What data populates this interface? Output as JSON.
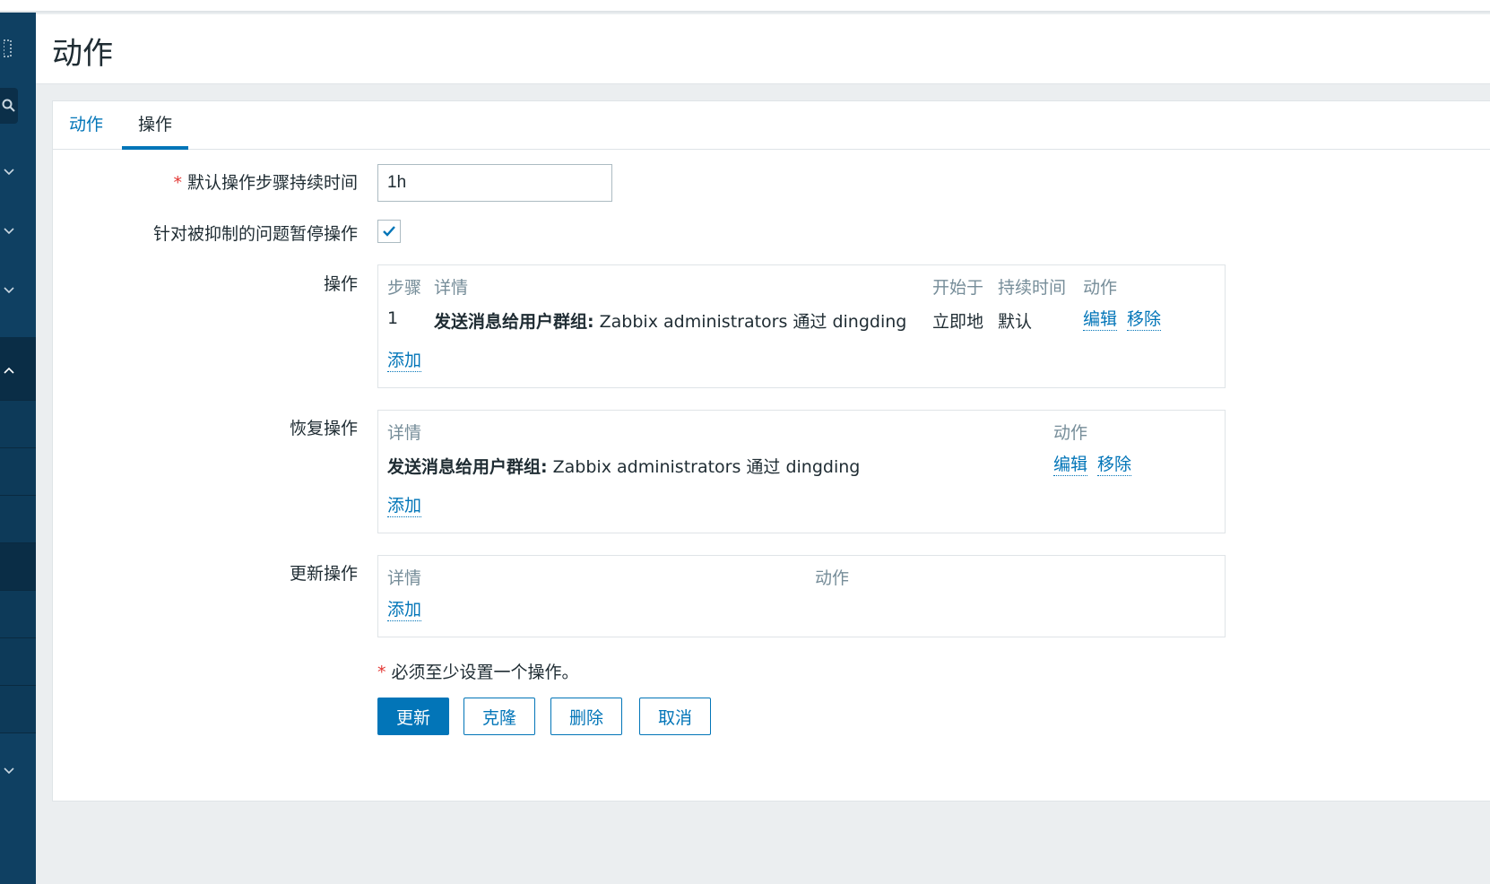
{
  "header": {
    "title": "动作"
  },
  "tabs": [
    {
      "label": "动作"
    },
    {
      "label": "操作"
    }
  ],
  "form": {
    "default_step_duration": {
      "label": "默认操作步骤持续时间",
      "value": "1h"
    },
    "pause_suppressed": {
      "label": "针对被抑制的问题暂停操作",
      "checked": true
    },
    "operations": {
      "label": "操作",
      "headers": {
        "step": "步骤",
        "details": "详情",
        "start": "开始于",
        "duration": "持续时间",
        "action": "动作"
      },
      "rows": [
        {
          "step": "1",
          "details_bold": "发送消息给用户群组:",
          "details_rest": " Zabbix administrators 通过 dingding",
          "start": "立即地",
          "duration": "默认",
          "edit": "编辑",
          "remove": "移除"
        }
      ],
      "add": "添加"
    },
    "recovery": {
      "label": "恢复操作",
      "headers": {
        "details": "详情",
        "action": "动作"
      },
      "rows": [
        {
          "details_bold": "发送消息给用户群组:",
          "details_rest": " Zabbix administrators 通过 dingding",
          "edit": "编辑",
          "remove": "移除"
        }
      ],
      "add": "添加"
    },
    "update": {
      "label": "更新操作",
      "headers": {
        "details": "详情",
        "action": "动作"
      },
      "add": "添加"
    },
    "required_note": "必须至少设置一个操作。",
    "buttons": {
      "update": "更新",
      "clone": "克隆",
      "delete": "删除",
      "cancel": "取消"
    }
  },
  "colors": {
    "accent": "#0275b8",
    "sidebar": "#0f4062",
    "required": "#e33734"
  }
}
